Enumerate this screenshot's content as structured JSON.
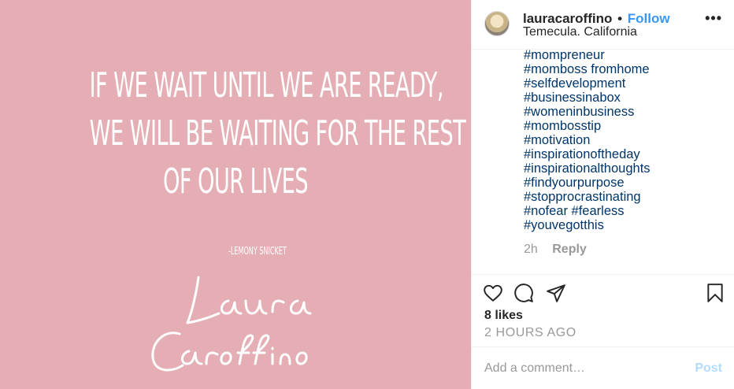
{
  "photo": {
    "quote_lines": [
      "IF WE WAIT UNTIL WE ARE READY,",
      "WE WILL BE WAITING FOR THE REST",
      "OF OUR LIVES"
    ],
    "quote_author": "-LEMONY SNICKET",
    "signature_lines": [
      "Laura",
      "Caroffino"
    ],
    "background_color": "#e4aeb4"
  },
  "header": {
    "username": "lauracaroffino",
    "separator": "•",
    "follow_label": "Follow",
    "location": "Temecula. California",
    "more_icon": "•••"
  },
  "comments": {
    "hashtags": [
      "#mompreneur",
      "#momboss fromhome",
      "#selfdevelopment",
      "#businessinabox",
      "#womeninbusiness",
      "#mombosstip",
      "#motivation",
      "#inspirationoftheday",
      "#inspirationalthoughts",
      "#findyourpurpose",
      "#stopprocrastinating",
      "#nofear #fearless",
      "#youvegotthis"
    ],
    "time": "2h",
    "reply_label": "Reply"
  },
  "actions": {
    "icons": [
      "heart-icon",
      "comment-icon",
      "share-icon",
      "bookmark-icon"
    ],
    "likes": "8 likes",
    "time_ago": "2 HOURS AGO"
  },
  "comment_box": {
    "placeholder": "Add a comment…",
    "post_label": "Post"
  },
  "colors": {
    "accent": "#3897f0",
    "hashtag": "#003569",
    "muted": "#999999",
    "post_disabled": "#b3dbff"
  }
}
